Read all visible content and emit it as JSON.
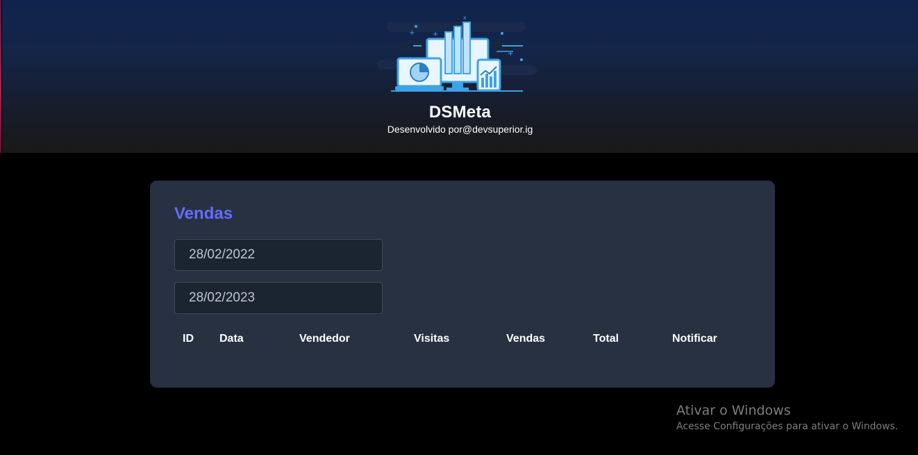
{
  "header": {
    "title": "DSMeta",
    "subtitle": "Desenvolvido por@devsuperior.ig",
    "logo_icon": "dashboard-devices-illustration"
  },
  "sales": {
    "title": "Vendas",
    "min_date": "28/02/2022",
    "max_date": "28/02/2023",
    "columns": [
      "ID",
      "Data",
      "Vendedor",
      "Visitas",
      "Vendas",
      "Total",
      "Notificar"
    ],
    "rows": []
  },
  "watermark": {
    "line1": "Ativar o Windows",
    "line2": "Acesse Configurações para ativar o Windows."
  },
  "colors": {
    "accent": "#646cff",
    "card_bg": "#283142",
    "input_bg": "#1b2431",
    "header_top": "#10234e"
  }
}
